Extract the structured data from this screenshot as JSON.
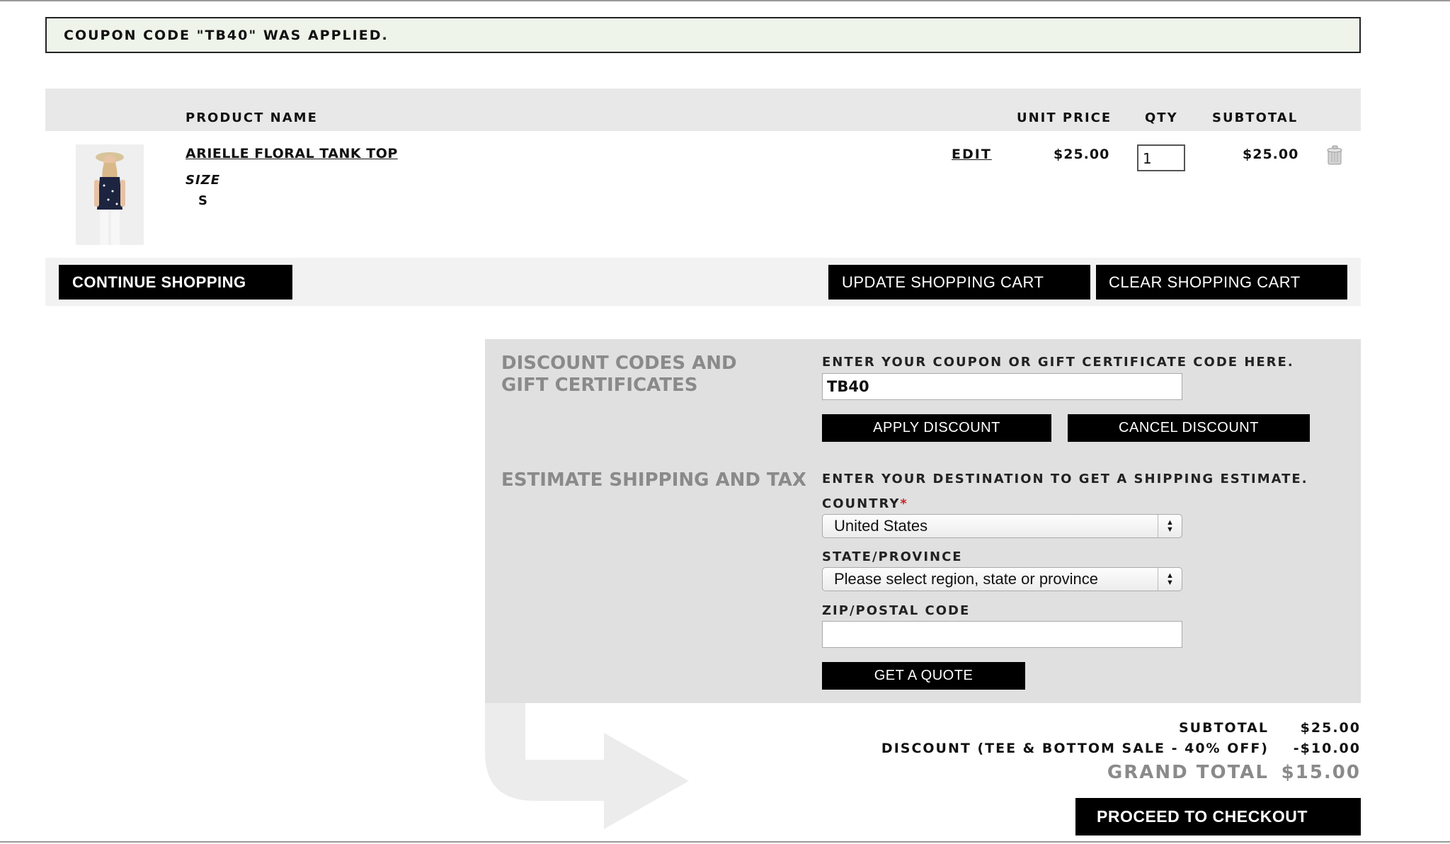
{
  "notice": {
    "text": "COUPON CODE \"TB40\" WAS APPLIED."
  },
  "cart": {
    "headers": {
      "product": "PRODUCT NAME",
      "unit_price": "UNIT PRICE",
      "qty": "QTY",
      "subtotal": "SUBTOTAL"
    },
    "items": [
      {
        "name": "ARIELLE FLORAL TANK TOP",
        "option_label": "SIZE",
        "option_value": "S",
        "edit_label": "EDIT",
        "unit_price": "$25.00",
        "qty": "1",
        "subtotal": "$25.00"
      }
    ],
    "actions": {
      "continue": "CONTINUE SHOPPING",
      "update": "UPDATE SHOPPING CART",
      "clear": "CLEAR SHOPPING CART"
    }
  },
  "discount": {
    "title": "DISCOUNT CODES AND GIFT CERTIFICATES",
    "instruction": "ENTER YOUR COUPON OR GIFT CERTIFICATE CODE HERE.",
    "code_value": "TB40",
    "apply_label": "APPLY DISCOUNT",
    "cancel_label": "CANCEL DISCOUNT"
  },
  "shipping": {
    "title": "ESTIMATE SHIPPING AND TAX",
    "instruction": "ENTER YOUR DESTINATION TO GET A SHIPPING ESTIMATE.",
    "country_label": "COUNTRY",
    "required_mark": "*",
    "country_value": "United States",
    "state_label": "STATE/PROVINCE",
    "state_value": "Please select region, state or province",
    "zip_label": "ZIP/POSTAL CODE",
    "zip_value": "",
    "quote_label": "GET A QUOTE"
  },
  "totals": {
    "subtotal_label": "SUBTOTAL",
    "subtotal_value": "$25.00",
    "discount_label": "DISCOUNT (TEE & BOTTOM SALE - 40% OFF)",
    "discount_value": "-$10.00",
    "grand_label": "GRAND TOTAL",
    "grand_value": "$15.00"
  },
  "checkout_label": "PROCEED TO CHECKOUT",
  "colors": {
    "notice_bg": "#eef4ea",
    "button_bg": "#000000",
    "panel_bg": "#e0e0e0",
    "muted_title": "#8a8a8a"
  },
  "icons": {
    "trash": "trash-can-icon",
    "select_arrows": "select-arrows-icon",
    "arrow_deco": "curved-arrow-icon"
  }
}
